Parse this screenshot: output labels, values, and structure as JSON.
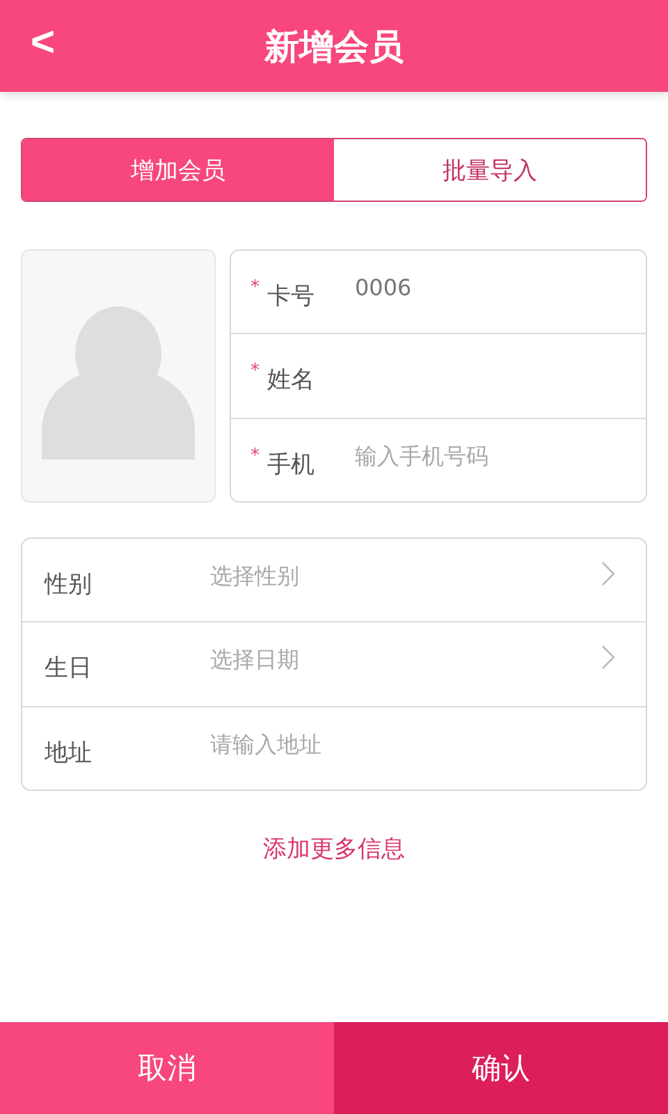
{
  "header": {
    "back": "<",
    "title": "新增会员"
  },
  "tabs": [
    {
      "label": "增加会员",
      "selected": true
    },
    {
      "label": "批量导入",
      "selected": false
    }
  ],
  "required_fields": [
    {
      "mark": "*",
      "label": "卡号",
      "value": "0006"
    },
    {
      "mark": "*",
      "label": "姓名"
    },
    {
      "mark": "*",
      "label": "手机",
      "placeholder": "输入手机号码"
    }
  ],
  "detail_fields": [
    {
      "kind": "select",
      "label": "性别",
      "placeholder": "选择性别"
    },
    {
      "kind": "select",
      "label": "生日",
      "placeholder": "选择日期"
    },
    {
      "kind": "input",
      "label": "地址",
      "placeholder": "请输入地址"
    }
  ],
  "more_link": "添加更多信息",
  "buttons": [
    {
      "kind": "cancel",
      "label": "取消"
    },
    {
      "kind": "confirm",
      "label": "确认"
    }
  ]
}
